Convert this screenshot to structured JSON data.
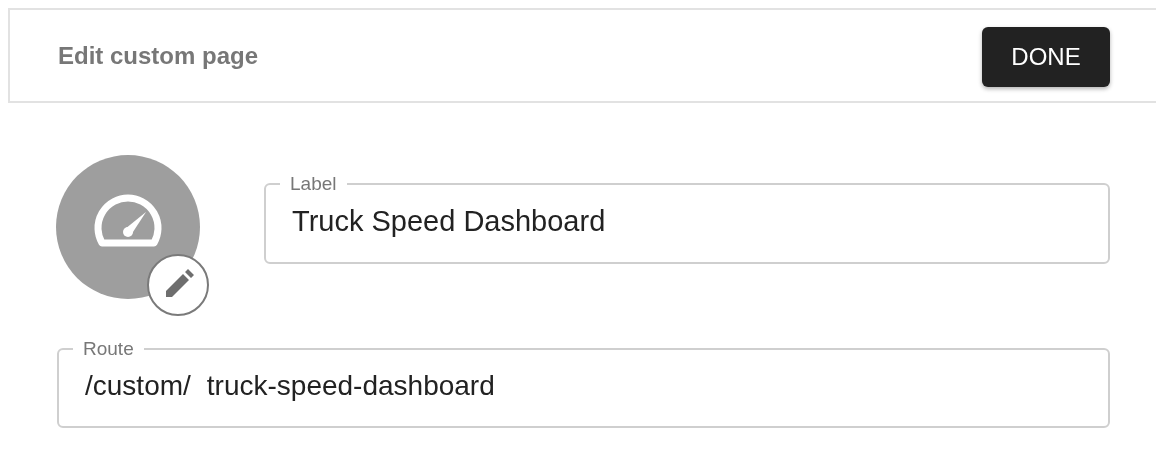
{
  "header": {
    "title": "Edit custom page",
    "done_button": "DONE"
  },
  "label_field": {
    "label": "Label",
    "value": "Truck Speed Dashboard"
  },
  "route_field": {
    "label": "Route",
    "prefix": "/custom/",
    "value": "truck-speed-dashboard"
  }
}
